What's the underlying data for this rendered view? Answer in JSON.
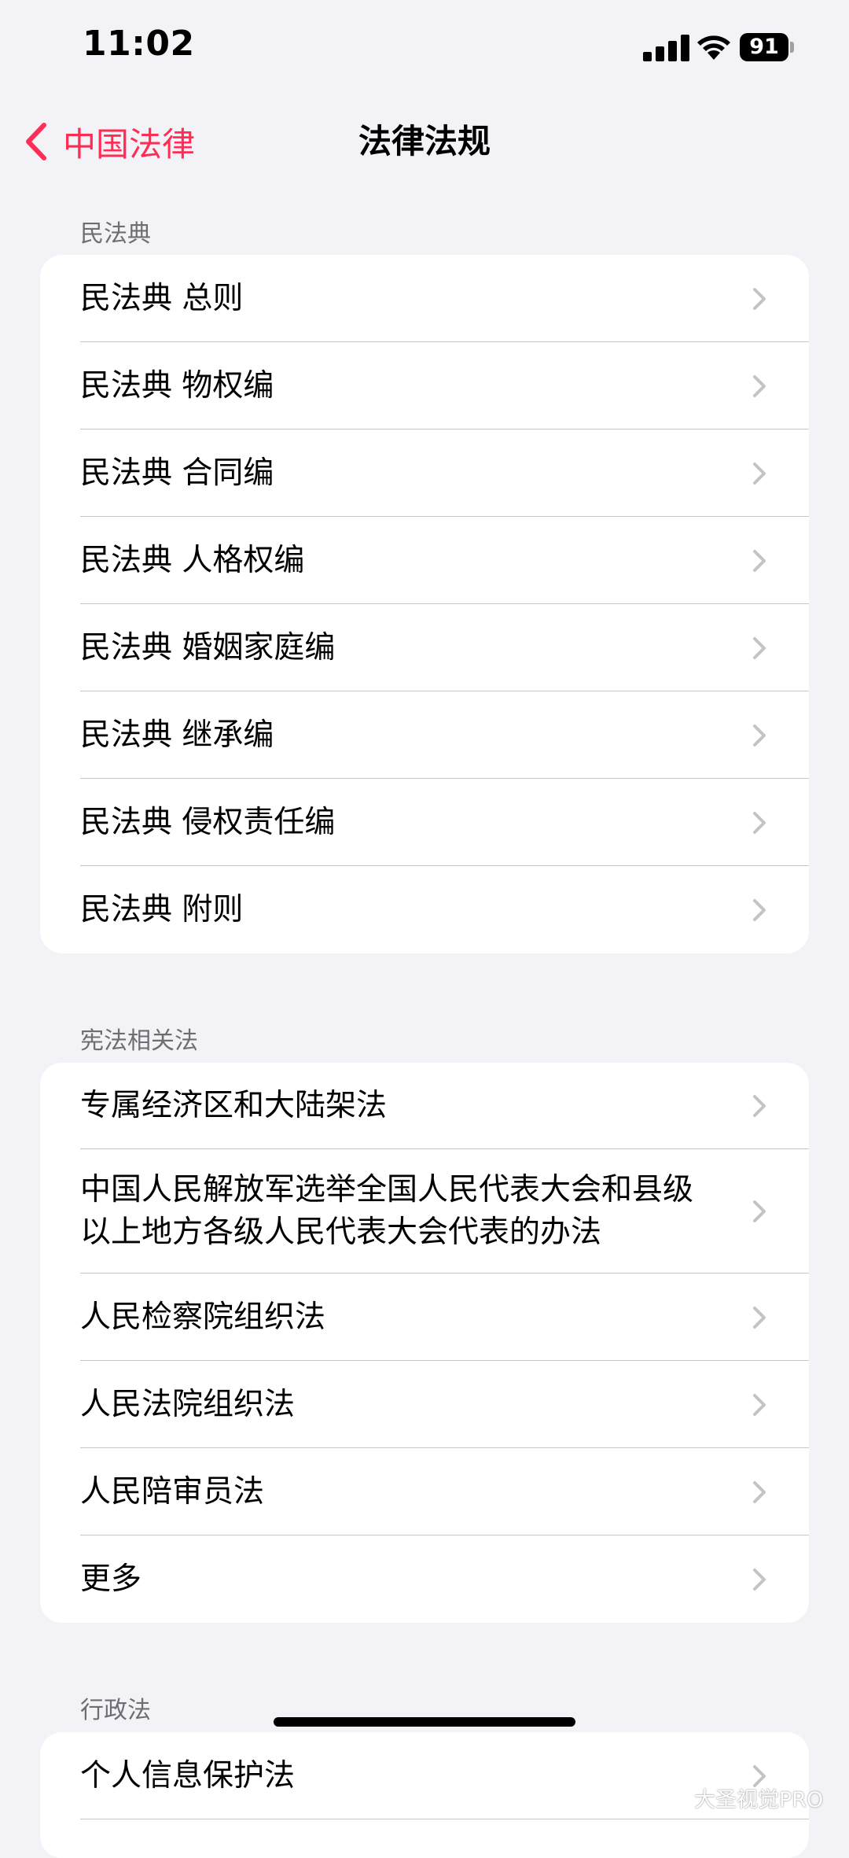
{
  "status_bar": {
    "time": "11:02",
    "battery": "91"
  },
  "nav": {
    "back_label": "中国法律",
    "title": "法律法规"
  },
  "sections": [
    {
      "header": "民法典",
      "items": [
        "民法典 总则",
        "民法典 物权编",
        "民法典 合同编",
        "民法典 人格权编",
        "民法典 婚姻家庭编",
        "民法典 继承编",
        "民法典 侵权责任编",
        "民法典 附则"
      ]
    },
    {
      "header": "宪法相关法",
      "items": [
        "专属经济区和大陆架法",
        "中国人民解放军选举全国人民代表大会和县级以上地方各级人民代表大会代表的办法",
        "人民检察院组织法",
        "人民法院组织法",
        "人民陪审员法",
        "更多"
      ]
    },
    {
      "header": "行政法",
      "items": [
        "个人信息保护法"
      ]
    }
  ],
  "watermark": "大圣视觉PRO",
  "colors": {
    "accent": "#ff2d55",
    "background": "#f2f2f7",
    "chevron": "#c4c4c7"
  }
}
